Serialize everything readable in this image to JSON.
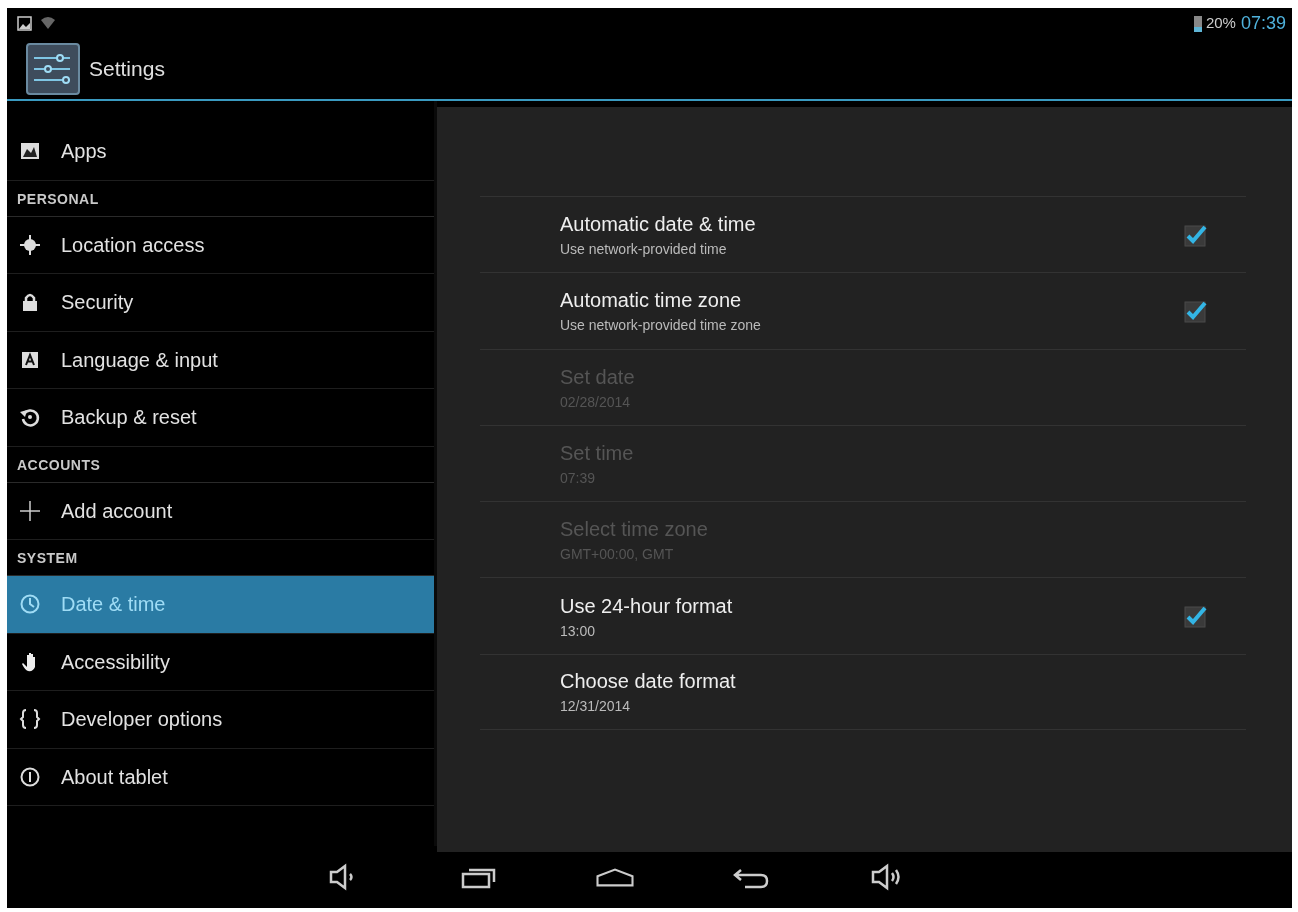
{
  "status_bar": {
    "battery": "20%",
    "time": "07:39"
  },
  "action_bar": {
    "title": "Settings"
  },
  "sidebar": {
    "items": [
      {
        "kind": "item",
        "label": "Apps",
        "selected": false
      },
      {
        "kind": "header",
        "label": "PERSONAL"
      },
      {
        "kind": "item",
        "label": "Location access",
        "selected": false
      },
      {
        "kind": "item",
        "label": "Security",
        "selected": false
      },
      {
        "kind": "item",
        "label": "Language & input",
        "selected": false
      },
      {
        "kind": "item",
        "label": "Backup & reset",
        "selected": false
      },
      {
        "kind": "header",
        "label": "ACCOUNTS"
      },
      {
        "kind": "item",
        "label": "Add account",
        "selected": false
      },
      {
        "kind": "header",
        "label": "SYSTEM"
      },
      {
        "kind": "item",
        "label": "Date & time",
        "selected": true
      },
      {
        "kind": "item",
        "label": "Accessibility",
        "selected": false
      },
      {
        "kind": "item",
        "label": "Developer options",
        "selected": false
      },
      {
        "kind": "item",
        "label": "About tablet",
        "selected": false
      }
    ]
  },
  "settings": [
    {
      "kind": "checkbox",
      "title": "Automatic date & time",
      "summary": "Use network-provided time",
      "disabled": false,
      "checked": true
    },
    {
      "kind": "checkbox",
      "title": "Automatic time zone",
      "summary": "Use network-provided time zone",
      "disabled": false,
      "checked": true
    },
    {
      "kind": "plain",
      "title": "Set date",
      "summary": "02/28/2014",
      "disabled": true
    },
    {
      "kind": "plain",
      "title": "Set time",
      "summary": "07:39",
      "disabled": true
    },
    {
      "kind": "plain",
      "title": "Select time zone",
      "summary": "GMT+00:00, GMT",
      "disabled": true
    },
    {
      "kind": "checkbox",
      "title": "Use 24-hour format",
      "summary": "13:00",
      "disabled": false,
      "checked": true
    },
    {
      "kind": "plain",
      "title": "Choose date format",
      "summary": "12/31/2014",
      "disabled": false
    }
  ]
}
